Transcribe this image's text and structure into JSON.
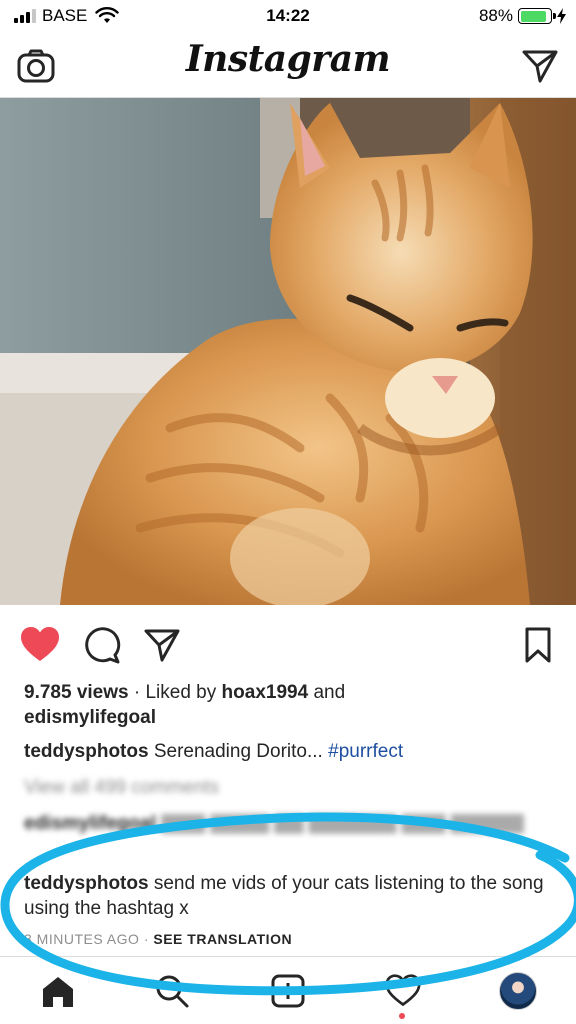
{
  "status_bar": {
    "carrier": "BASE",
    "time": "14:22",
    "battery_percent": "88%",
    "battery_level": 0.88,
    "battery_color": "#4cd964"
  },
  "header": {
    "title": "Instagram",
    "left_icon": "camera-icon",
    "right_icon": "direct-message-icon"
  },
  "post": {
    "views": "9.785 views",
    "liked_by_prefix": "Liked by",
    "liked_by_user1": "hoax1994",
    "liked_by_and": "and",
    "liked_by_user2": "edismylifegoal",
    "caption_user": "teddysphotos",
    "caption_text": "Serenading Dorito...",
    "caption_hashtag": "#purrfect",
    "view_all_comments": "View all 499 comments",
    "previous_comment": "edismylifegoal",
    "comment_user": "teddysphotos",
    "comment_text": "send me vids of your cats listening to the song using the hashtag x",
    "timestamp": "3 MINUTES AGO",
    "separator": "·",
    "see_translation": "SEE TRANSLATION",
    "liked": true,
    "like_color": "#ed4956"
  },
  "tab_bar": {
    "items": [
      "home-icon",
      "search-icon",
      "add-post-icon",
      "activity-icon",
      "profile-avatar"
    ],
    "active": "home-icon"
  },
  "annotation": {
    "ring_color": "#1bb3e8"
  }
}
